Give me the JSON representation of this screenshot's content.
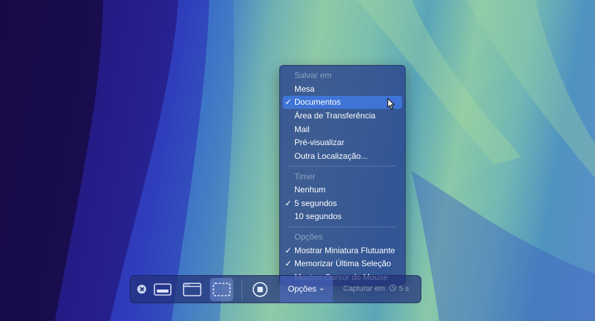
{
  "menu": {
    "save_header": "Salvar em",
    "save_items": [
      {
        "label": "Mesa",
        "checked": false
      },
      {
        "label": "Documentos",
        "checked": true,
        "highlighted": true
      },
      {
        "label": "Área de Transferência",
        "checked": false
      },
      {
        "label": "Mail",
        "checked": false
      },
      {
        "label": "Pré-visualizar",
        "checked": false
      },
      {
        "label": "Outra Localização...",
        "checked": false
      }
    ],
    "timer_header": "Timer",
    "timer_items": [
      {
        "label": "Nenhum",
        "checked": false
      },
      {
        "label": "5 segundos",
        "checked": true
      },
      {
        "label": "10 segundos",
        "checked": false
      }
    ],
    "options_header": "Opções",
    "options_items": [
      {
        "label": "Mostrar Miniatura Flutuante",
        "checked": true
      },
      {
        "label": "Memorizar Última Seleção",
        "checked": true
      },
      {
        "label": "Mostrar Cursor do Mouse",
        "checked": false
      }
    ],
    "check_glyph": "✓"
  },
  "toolbar": {
    "options_label": "Opções",
    "options_chevron": "⌄",
    "capture_label": "Capturar em",
    "capture_timer": "5 s",
    "icons": [
      "close-icon",
      "capture-window-icon",
      "capture-entire-screen-icon",
      "capture-selection-icon",
      "record-icon"
    ]
  },
  "colors": {
    "menu_highlight": "#3f74d6",
    "menu_background": "#263e8c"
  }
}
